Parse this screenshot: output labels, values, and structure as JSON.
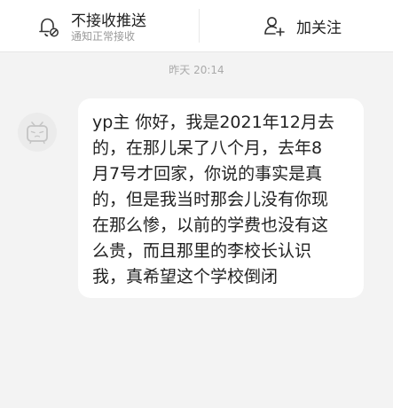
{
  "header": {
    "no_push": {
      "title": "不接收推送",
      "subtitle": "通知正常接收",
      "icon": "bell-muted-icon"
    },
    "follow": {
      "label": "加关注",
      "icon": "user-plus-icon"
    }
  },
  "chat": {
    "timestamp": "昨天 20:14",
    "message": {
      "lines": [
        "yp主 你好，我是2021年12月去",
        "的，在那儿呆了八个月，去年8",
        "月7号才回家，你说的事实是真",
        "的，但是我当时那会儿没有你现",
        "在那么惨，以前的学费也没有这",
        "么贵，而且那里的李校长认识",
        "我，真希望这个学校倒闭"
      ]
    }
  }
}
